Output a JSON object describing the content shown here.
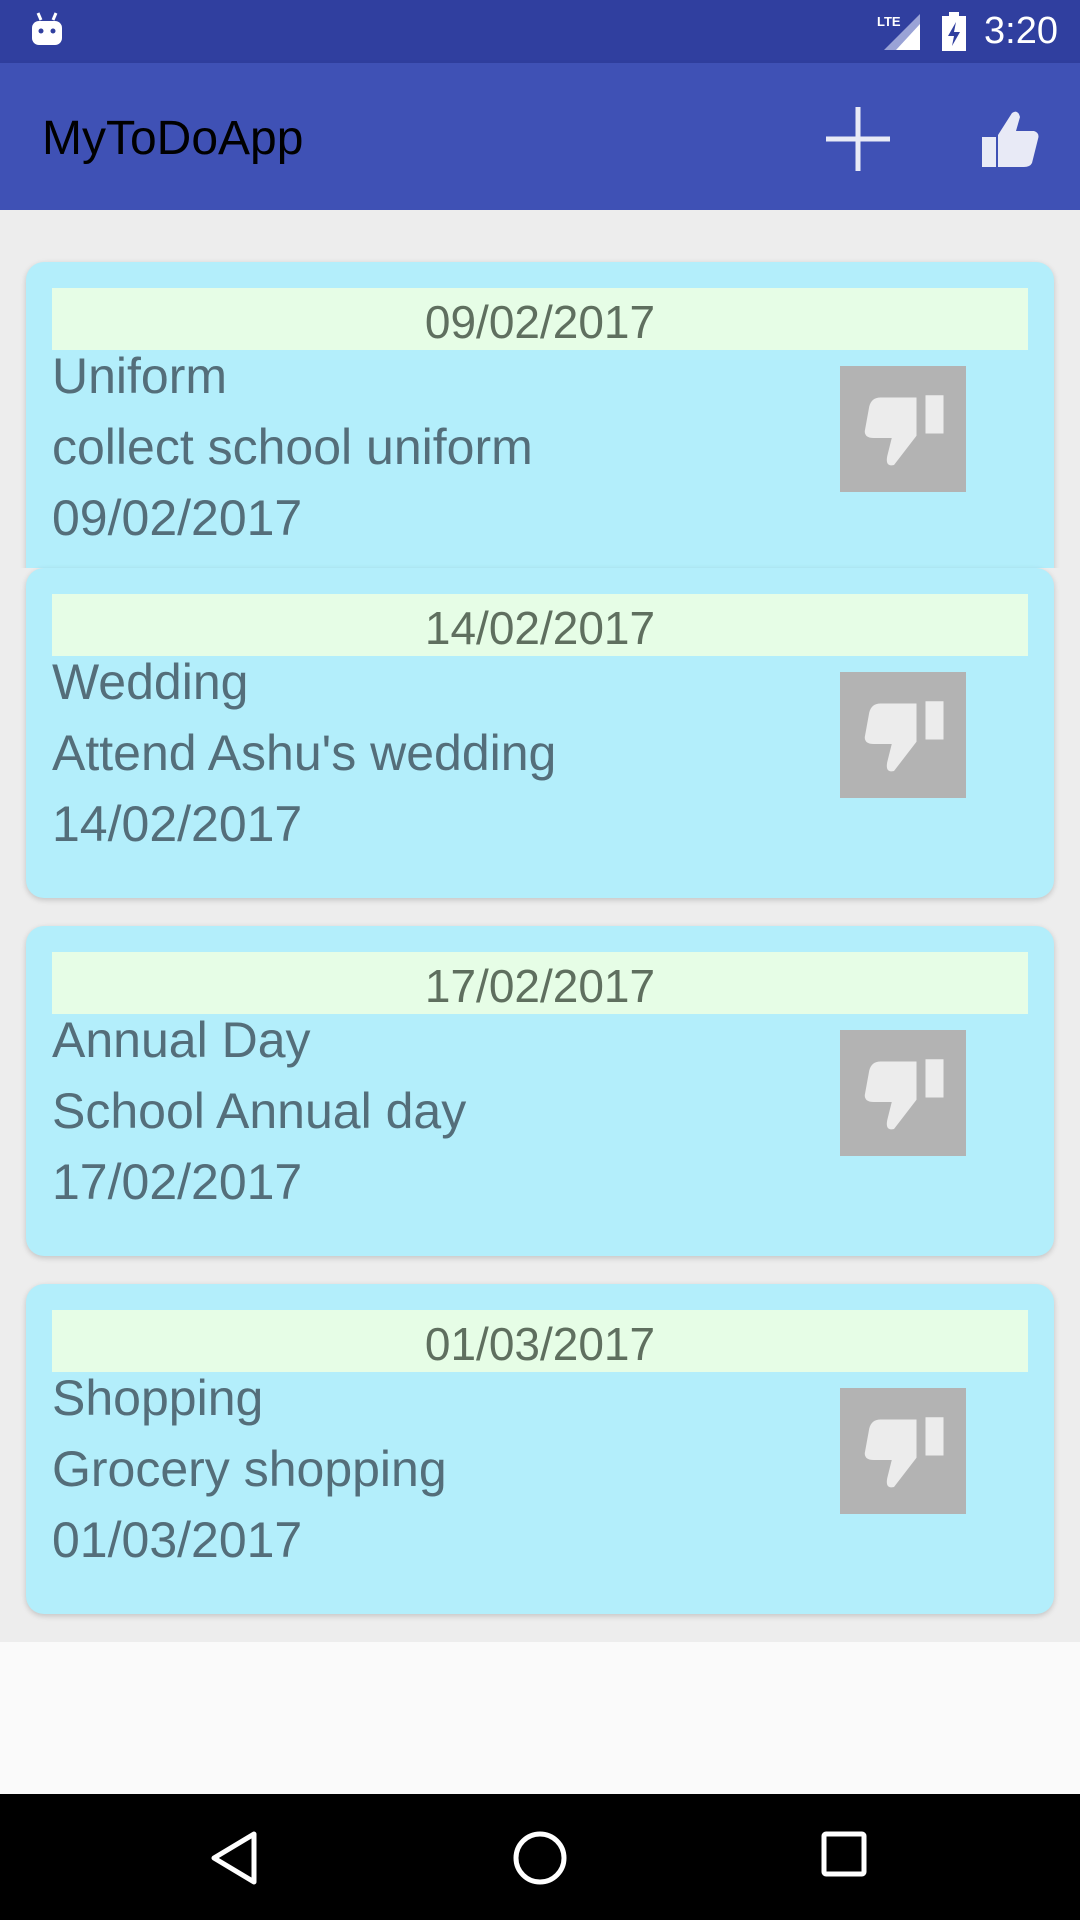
{
  "status_bar": {
    "time": "3:20",
    "network": "LTE",
    "icons": [
      "android-icon",
      "lte-signal-icon",
      "battery-charging-icon"
    ]
  },
  "app_bar": {
    "title": "MyToDoApp",
    "actions": [
      "add-icon",
      "thumbs-up-icon"
    ]
  },
  "items": [
    {
      "header_date": "09/02/2017",
      "title": "Uniform",
      "description": "collect school uniform",
      "date": "09/02/2017"
    },
    {
      "header_date": "14/02/2017",
      "title": "Wedding",
      "description": "Attend Ashu's wedding",
      "date": "14/02/2017"
    },
    {
      "header_date": "17/02/2017",
      "title": "Annual Day",
      "description": "School Annual day",
      "date": "17/02/2017"
    },
    {
      "header_date": "01/03/2017",
      "title": "Shopping",
      "description": "Grocery shopping",
      "date": "01/03/2017"
    }
  ],
  "colors": {
    "status_bar": "#303f9f",
    "app_bar": "#3f51b5",
    "card": "#b3eefb",
    "date_header": "#e6fde6",
    "text": "#546e7a",
    "dislike_button": "#b3b3b3"
  },
  "nav_bar": {
    "icons": [
      "back-icon",
      "home-icon",
      "recents-icon"
    ]
  }
}
